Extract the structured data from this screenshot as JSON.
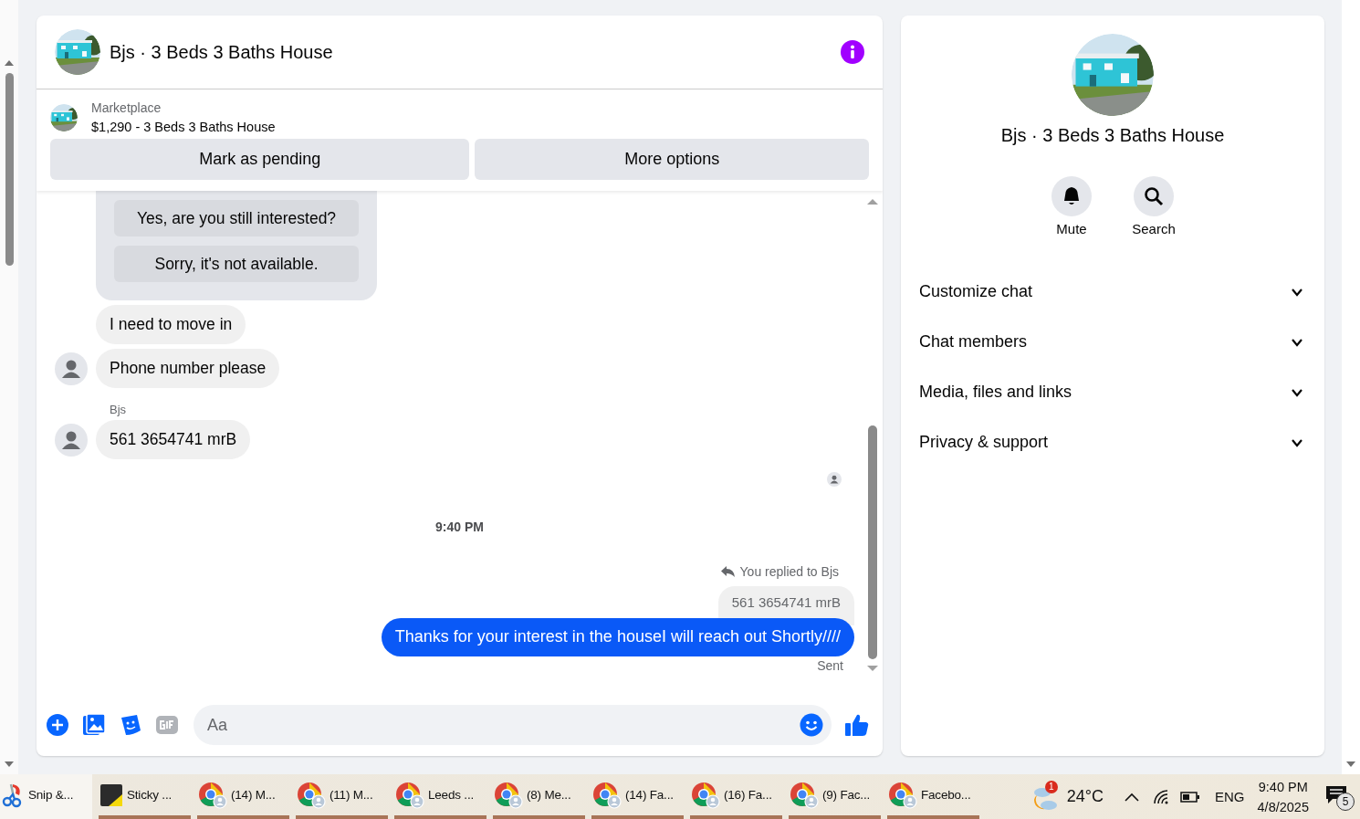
{
  "chat": {
    "title": "Bjs · 3 Beds 3 Baths House",
    "listing": {
      "source": "Marketplace",
      "summary": "$1,290 - 3 Beds 3 Baths House"
    },
    "actions": [
      "Mark as pending",
      "More options"
    ],
    "messages": [
      {
        "kind": "quick-replies",
        "options": [
          "Yes, are you still interested?",
          "Sorry, it's not available."
        ]
      },
      {
        "kind": "incoming",
        "text": "I need to move in",
        "avatar": false
      },
      {
        "kind": "incoming",
        "text": "Phone number please",
        "avatar": true
      },
      {
        "kind": "sender",
        "text": "Bjs"
      },
      {
        "kind": "incoming",
        "text": "561 3654741 mrB",
        "avatar": true
      },
      {
        "kind": "seen"
      },
      {
        "kind": "time",
        "text": "9:40 PM"
      },
      {
        "kind": "reply-note",
        "text": "You replied to Bjs"
      },
      {
        "kind": "quoted",
        "text": "561 3654741 mrB"
      },
      {
        "kind": "outgoing",
        "text": "Thanks for your interest in the houseI will reach out Shortly////"
      },
      {
        "kind": "status",
        "text": "Sent"
      }
    ],
    "composer": {
      "placeholder": "Aa"
    }
  },
  "details": {
    "title": "Bjs · 3 Beds 3 Baths House",
    "actions": [
      {
        "kind": "mute",
        "label": "Mute"
      },
      {
        "kind": "search",
        "label": "Search"
      }
    ],
    "sections": [
      {
        "label": "Customize chat",
        "expanded": false
      },
      {
        "label": "Chat members",
        "expanded": false
      },
      {
        "label": "Media, files and links",
        "expanded": false
      },
      {
        "label": "Privacy & support",
        "expanded": false
      }
    ]
  },
  "taskbar": {
    "apps": [
      {
        "kind": "snip",
        "label": "Snip &...",
        "selected": true
      },
      {
        "kind": "notes",
        "label": "Sticky ...",
        "selected": false
      },
      {
        "kind": "browser",
        "label": "(14) M...",
        "selected": false
      },
      {
        "kind": "browser",
        "label": "(11) M...",
        "selected": false
      },
      {
        "kind": "browser",
        "label": "Leeds ...",
        "selected": false
      },
      {
        "kind": "browser",
        "label": "(8) Me...",
        "selected": false
      },
      {
        "kind": "browser",
        "label": "(14) Fa...",
        "selected": false
      },
      {
        "kind": "browser",
        "label": "(16) Fa...",
        "selected": false
      },
      {
        "kind": "browser",
        "label": "(9) Fac...",
        "selected": false
      },
      {
        "kind": "browser",
        "label": "Facebo...",
        "selected": false
      }
    ],
    "weather": {
      "badge": "1",
      "temperature": "24°C"
    },
    "language": "ENG",
    "time": "9:40 PM",
    "date": "4/8/2025",
    "notifications": "5"
  }
}
